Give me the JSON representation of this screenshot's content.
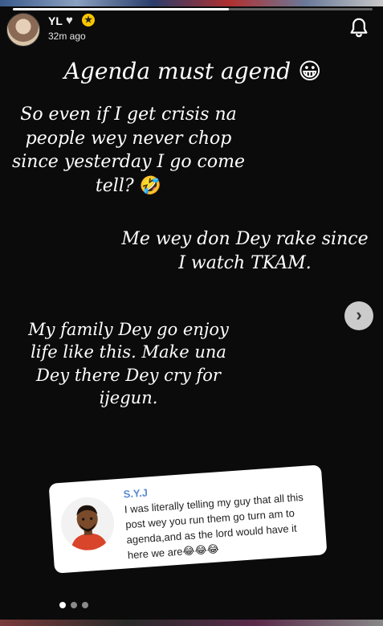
{
  "story": {
    "progress_percent": 60,
    "user": {
      "name": "YL",
      "heart_icon": "♥",
      "badge_icon": "★",
      "timestamp": "32m ago"
    }
  },
  "content": {
    "line1": "Agenda must agend",
    "line1_emoji": "😀",
    "block2": "So even if I get crisis na people wey never chop since yesterday I go come tell?",
    "block2_emoji": "🤣",
    "block3": "Me wey don Dey rake since I watch TKAM.",
    "block4": "My family Dey go enjoy life like this.  Make una Dey there Dey cry for ijegun."
  },
  "reply": {
    "name": "S.Y.J",
    "text": "I was literally telling my guy that all this post wey you run them go turn am to agenda,and as the lord would have it here we are",
    "emojis": "😂😂😂"
  },
  "pagination": {
    "total": 3,
    "active_index": 0
  },
  "icons": {
    "bell": "bell-icon",
    "next": "chevron-right-icon"
  },
  "colors": {
    "background": "#0b0b0b",
    "badge": "#f7c600",
    "reply_name": "#5b8bd6"
  }
}
